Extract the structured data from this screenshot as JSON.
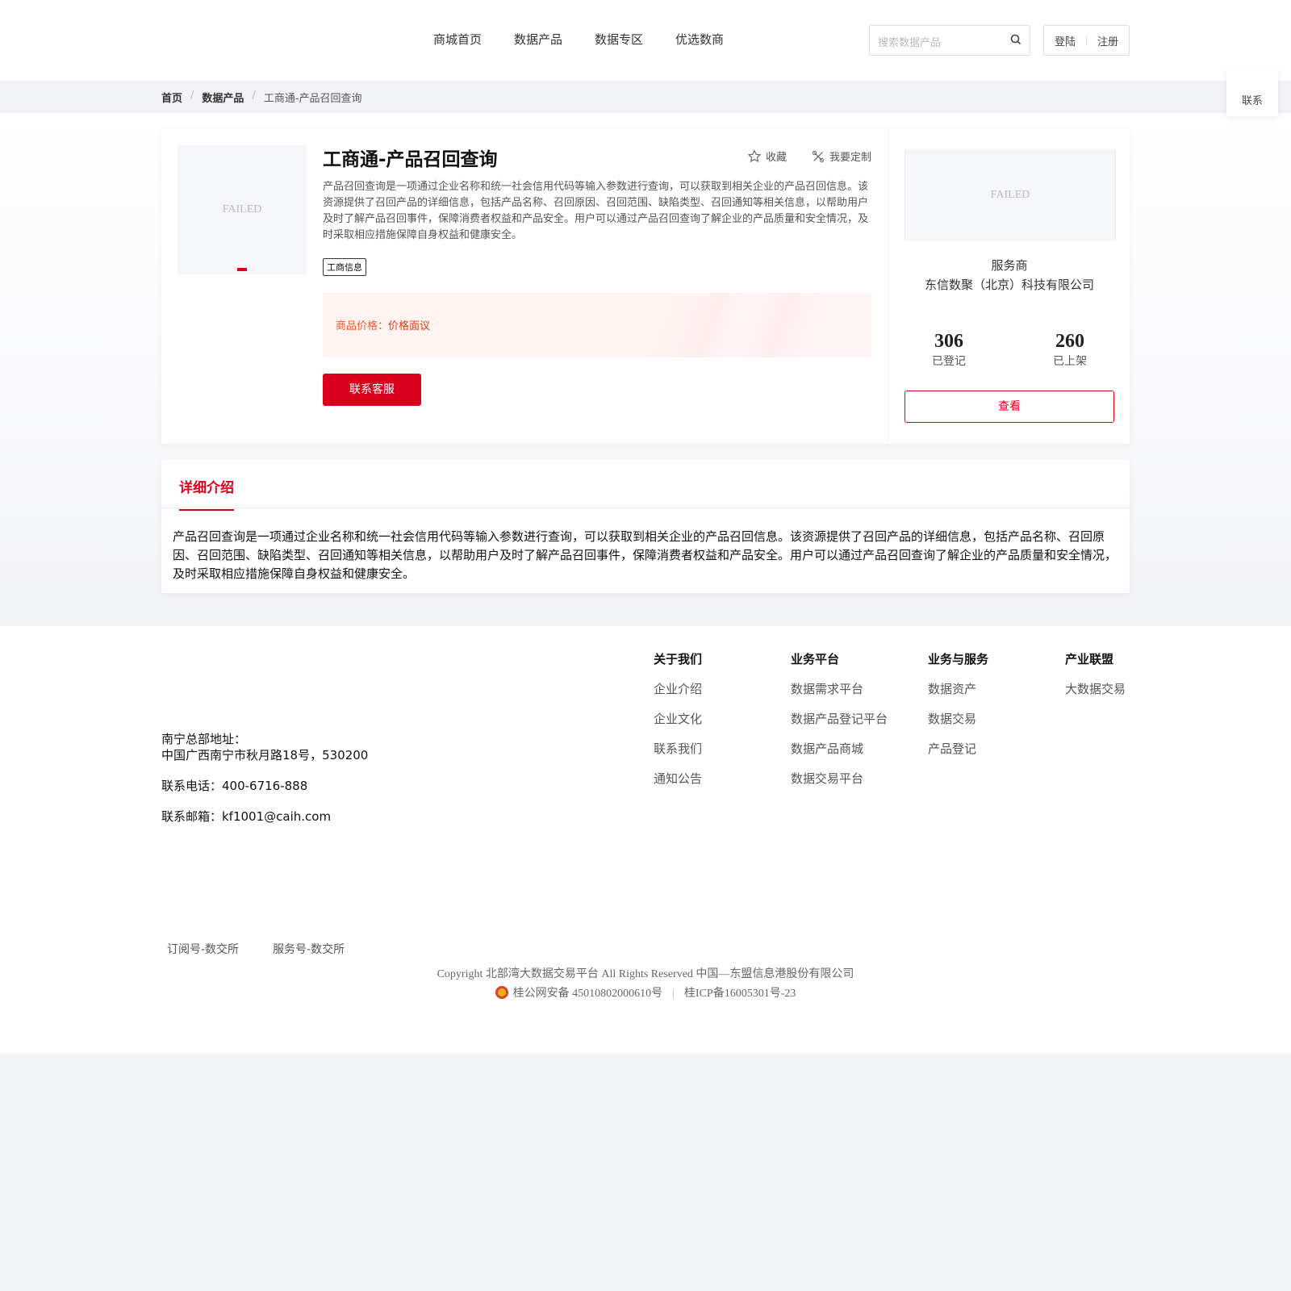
{
  "nav": {
    "items": [
      "商城首页",
      "数据产品",
      "数据专区",
      "优选数商"
    ],
    "search_placeholder": "搜索数据产品",
    "login": "登陆",
    "register": "注册"
  },
  "breadcrumb": [
    "首页",
    "数据产品",
    "工商通-产品召回查询"
  ],
  "float_contact": "联系",
  "product": {
    "image_alt": "FAILED",
    "title": "工商通-产品召回查询",
    "favorite": "收藏",
    "customize": "我要定制",
    "description": "产品召回查询是一项通过企业名称和统一社会信用代码等输入参数进行查询，可以获取到相关企业的产品召回信息。该资源提供了召回产品的详细信息，包括产品名称、召回原因、召回范围、缺陷类型、召回通知等相关信息，以帮助用户及时了解产品召回事件，保障消费者权益和产品安全。用户可以通过产品召回查询了解企业的产品质量和安全情况，及时采取相应措施保障自身权益和健康安全。",
    "tag": "工商信息",
    "price_label": "商品价格：",
    "price_value": "价格面议",
    "contact_button": "联系客服"
  },
  "provider": {
    "logo_alt": "FAILED",
    "label": "服务商",
    "name": "东信数聚（北京）科技有限公司",
    "registered": "306",
    "registered_label": "已登记",
    "listed": "260",
    "listed_label": "已上架",
    "view_button": "查看"
  },
  "detail": {
    "tab": "详细介绍",
    "text": "产品召回查询是一项通过企业名称和统一社会信用代码等输入参数进行查询，可以获取到相关企业的产品召回信息。该资源提供了召回产品的详细信息，包括产品名称、召回原因、召回范围、缺陷类型、召回通知等相关信息，以帮助用户及时了解产品召回事件，保障消费者权益和产品安全。用户可以通过产品召回查询了解企业的产品质量和安全情况，及时采取相应措施保障自身权益和健康安全。"
  },
  "footer": {
    "address_label": "南宁总部地址：",
    "address": "中国广西南宁市秋月路18号，530200",
    "phone": "联系电话：400-6716-888",
    "email": "联系邮箱：kf1001@caih.com",
    "columns": [
      {
        "title": "关于我们",
        "links": [
          "企业介绍",
          "企业文化",
          "联系我们",
          "通知公告"
        ]
      },
      {
        "title": "业务平台",
        "links": [
          "数据需求平台",
          "数据产品登记平台",
          "数据产品商城",
          "数据交易平台"
        ]
      },
      {
        "title": "业务与服务",
        "links": [
          "数据资产",
          "数据交易",
          "产品登记"
        ]
      },
      {
        "title": "产业联盟",
        "links": [
          "大数据交易"
        ]
      }
    ],
    "subscriptions": [
      "订阅号-数交所",
      "服务号-数交所"
    ],
    "copyright": "Copyright 北部湾大数据交易平台 All Rights Reserved 中国—东盟信息港股份有限公司",
    "police": "桂公网安备 45010802000610号",
    "icp": "桂ICP备16005301号-23"
  }
}
